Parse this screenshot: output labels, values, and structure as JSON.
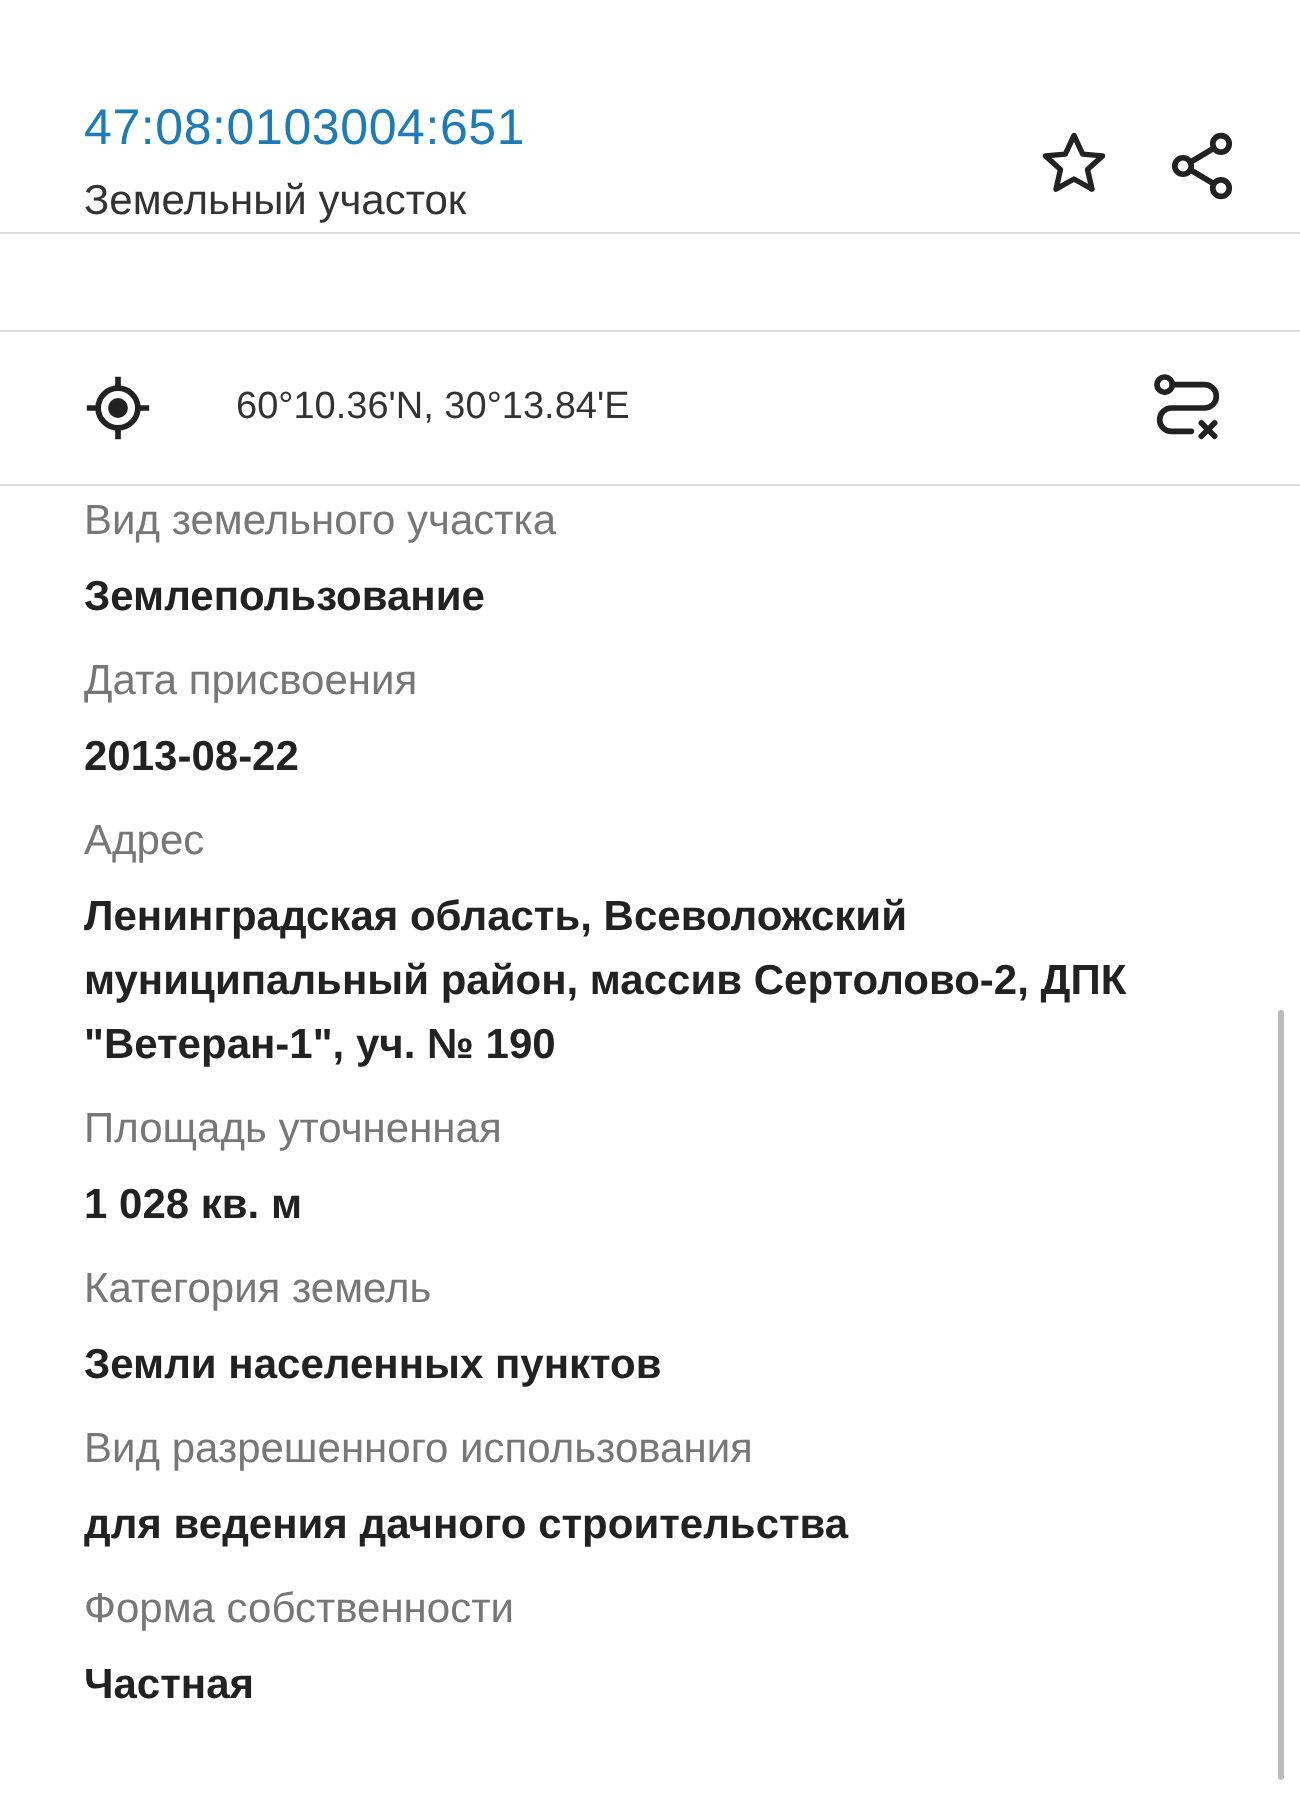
{
  "header": {
    "cadastral_number": "47:08:0103004:651",
    "subtitle": "Земельный участок"
  },
  "coordinates": "60°10.36'N, 30°13.84'E",
  "fields": [
    {
      "label": "Вид земельного участка",
      "value": "Землепользование"
    },
    {
      "label": "Дата присвоения",
      "value": "2013-08-22"
    },
    {
      "label": "Адрес",
      "value": "Ленинградская область, Всеволожский муниципальный район, массив Сертолово-2, ДПК \"Ветеран-1\", уч. № 190"
    },
    {
      "label": "Площадь уточненная",
      "value": "1 028 кв. м"
    },
    {
      "label": "Категория земель",
      "value": "Земли населенных пунктов"
    },
    {
      "label": "Вид разрешенного использования",
      "value": "для ведения дачного строительства"
    },
    {
      "label": "Форма собственности",
      "value": "Частная"
    }
  ]
}
